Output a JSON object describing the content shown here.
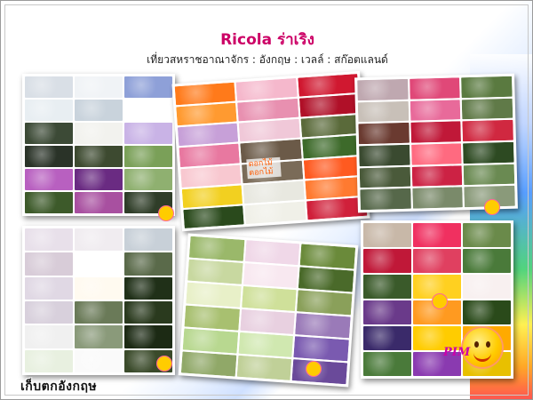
{
  "header": {
    "title": "Ricola ร่าเริง",
    "subtitle": "เที่ยวสหราชอาณาจักร : อังกฤษ : เวลล์ : สก๊อตแลนด์"
  },
  "footer": {
    "caption": "เก็บตกอังกฤษ",
    "signature": "PIM"
  },
  "photo_label": "ดอกไม้ ดอกไม้",
  "collages": [
    {
      "name": "collage-hydrangea",
      "cols": 3,
      "tiles": [
        "#d9dfe6",
        "#f0f3f6",
        "#8ea0d8",
        "#e8eef2",
        "#c9d3dc",
        "#ffffff",
        "#3c4a36",
        "#f2f2ee",
        "#c9b3e6",
        "#2a3328",
        "#3d4a30",
        "#7aa058",
        "#b860c0",
        "#6a2b82",
        "#8fb070",
        "#3d5a2a",
        "#a850a0",
        "#2f3d28"
      ]
    },
    {
      "name": "collage-roses",
      "cols": 3,
      "tiles": [
        "#ff7a1a",
        "#f5b8cc",
        "#d01830",
        "#ff9a30",
        "#e890b0",
        "#b01028",
        "#c7a0d8",
        "#f0c8d8",
        "#5a6a3a",
        "#e878a0",
        "#6b5a48",
        "#3d6a2a",
        "#f8c8d0",
        "#7a6b58",
        "#ff5a20",
        "#f2d020",
        "#e8e8e0",
        "#ff7a30",
        "#2a4a1c",
        "#f0f0e8",
        "#d0203a"
      ]
    },
    {
      "name": "collage-gardens",
      "cols": 3,
      "tiles": [
        "#bfa8b0",
        "#e04878",
        "#5a7a40",
        "#c8c0b8",
        "#e86a9a",
        "#607a48",
        "#6a3a30",
        "#c01838",
        "#d02840",
        "#3a4a30",
        "#ff6a80",
        "#2d4a22",
        "#4a5a3a",
        "#cc2244",
        "#6a8a52",
        "#56684a",
        "#7a8a6a",
        "#8a9a7a"
      ]
    },
    {
      "name": "collage-blossoms",
      "cols": 3,
      "tiles": [
        "#e8e0ea",
        "#f0ecf0",
        "#c8d0d8",
        "#d8ccd8",
        "#ffffff",
        "#5a6a4a",
        "#e0d8e4",
        "#fffaf0",
        "#203018",
        "#d8d0dc",
        "#6a7a58",
        "#2a3a1e",
        "#f0f0f0",
        "#8a9a7a",
        "#1c2a14",
        "#e8f0e0",
        "#fafafa",
        "#3a4a2a"
      ]
    },
    {
      "name": "collage-magnolia",
      "cols": 3,
      "tiles": [
        "#9ab86a",
        "#f0d8e8",
        "#6a8a3a",
        "#c8d8a0",
        "#f8e8f0",
        "#4a6a2a",
        "#e8f0c8",
        "#cfe09a",
        "#8aa05a",
        "#a8c070",
        "#e8d0e0",
        "#9a7ab8",
        "#b8d890",
        "#d0e8b0",
        "#7a5ab0",
        "#90a868",
        "#c0d098",
        "#6a4a9a"
      ]
    },
    {
      "name": "collage-baskets",
      "cols": 3,
      "tiles": [
        "#c8b8a8",
        "#f03060",
        "#6a8a4a",
        "#c01838",
        "#e04060",
        "#4a7a3a",
        "#3a5a2a",
        "#ffd020",
        "#f8f0f0",
        "#6a3a8a",
        "#ff9a20",
        "#2a4a1a",
        "#3a2a6a",
        "#ffcc00",
        "#ffaa00",
        "#4a7a3a",
        "#8a3ab0",
        "#e8c000"
      ]
    }
  ],
  "colors": {
    "title": "#cc0066",
    "accent": "#ff9900"
  }
}
